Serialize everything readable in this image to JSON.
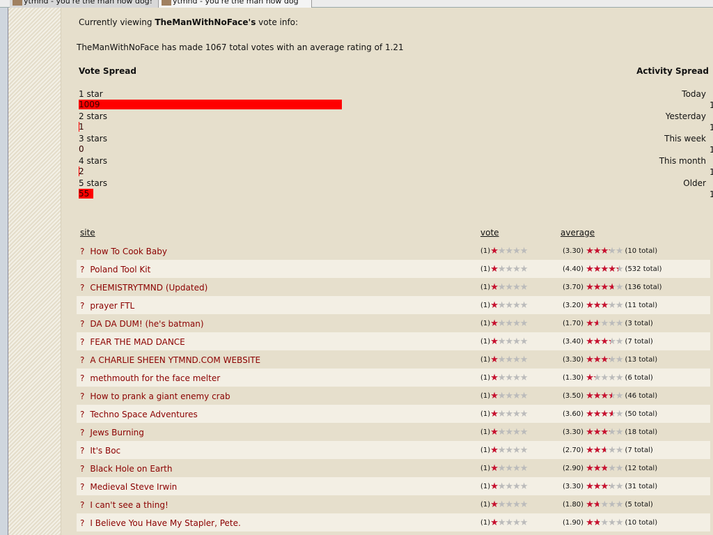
{
  "tabs": [
    {
      "title": "ytmnd - you're the man now dog!"
    },
    {
      "title": "ytmnd - you're the man now dog"
    }
  ],
  "intro": {
    "prefix": "Currently viewing ",
    "user": "TheManWithNoFace's",
    "suffix": " vote info:"
  },
  "summary": "TheManWithNoFace has made 1067 total votes with an average rating of 1.21",
  "vote_spread": {
    "title": "Vote Spread",
    "max": 1009,
    "items": [
      {
        "label": "1 star",
        "count": 1009
      },
      {
        "label": "2 stars",
        "count": 1
      },
      {
        "label": "3 stars",
        "count": 0
      },
      {
        "label": "4 stars",
        "count": 2
      },
      {
        "label": "5 stars",
        "count": 55
      }
    ]
  },
  "activity_spread": {
    "title": "Activity Spread",
    "items": [
      {
        "label": "Today",
        "value": "1"
      },
      {
        "label": "Yesterday",
        "value": "1"
      },
      {
        "label": "This week",
        "value": "1"
      },
      {
        "label": "This month",
        "value": "1"
      },
      {
        "label": "Older",
        "value": "1"
      }
    ]
  },
  "table": {
    "headers": {
      "site": "site",
      "vote": "vote",
      "average": "average"
    },
    "colors": {
      "star_on": "#c8102e",
      "star_off": "#bbbbbb",
      "link": "#8b0000"
    },
    "rows": [
      {
        "site": "How To Cook Baby",
        "vote": 1,
        "avg": 3.3,
        "total": "10 total"
      },
      {
        "site": "Poland Tool Kit",
        "vote": 1,
        "avg": 4.4,
        "total": "532 total"
      },
      {
        "site": "CHEMISTRYTMND (Updated)",
        "vote": 1,
        "avg": 3.7,
        "total": "136 total"
      },
      {
        "site": "prayer FTL",
        "vote": 1,
        "avg": 3.2,
        "total": "11 total"
      },
      {
        "site": "DA DA DUM! (he's batman)",
        "vote": 1,
        "avg": 1.7,
        "total": "3 total"
      },
      {
        "site": "FEAR THE MAD DANCE",
        "vote": 1,
        "avg": 3.4,
        "total": "7 total"
      },
      {
        "site": "A CHARLIE SHEEN YTMND.COM WEBSITE",
        "vote": 1,
        "avg": 3.3,
        "total": "13 total"
      },
      {
        "site": "methmouth for the face melter",
        "vote": 1,
        "avg": 1.3,
        "total": "6 total"
      },
      {
        "site": "How to prank a giant enemy crab",
        "vote": 1,
        "avg": 3.5,
        "total": "46 total"
      },
      {
        "site": "Techno Space Adventures",
        "vote": 1,
        "avg": 3.6,
        "total": "50 total"
      },
      {
        "site": "Jews Burning",
        "vote": 1,
        "avg": 3.3,
        "total": "18 total"
      },
      {
        "site": "It's Boc",
        "vote": 1,
        "avg": 2.7,
        "total": "7 total"
      },
      {
        "site": "Black Hole on Earth",
        "vote": 1,
        "avg": 2.9,
        "total": "12 total"
      },
      {
        "site": "Medieval Steve Irwin",
        "vote": 1,
        "avg": 3.3,
        "total": "31 total"
      },
      {
        "site": "I can't see a thing!",
        "vote": 1,
        "avg": 1.8,
        "total": "5 total"
      },
      {
        "site": "I Believe You Have My Stapler, Pete.",
        "vote": 1,
        "avg": 1.9,
        "total": "10 total"
      }
    ]
  }
}
